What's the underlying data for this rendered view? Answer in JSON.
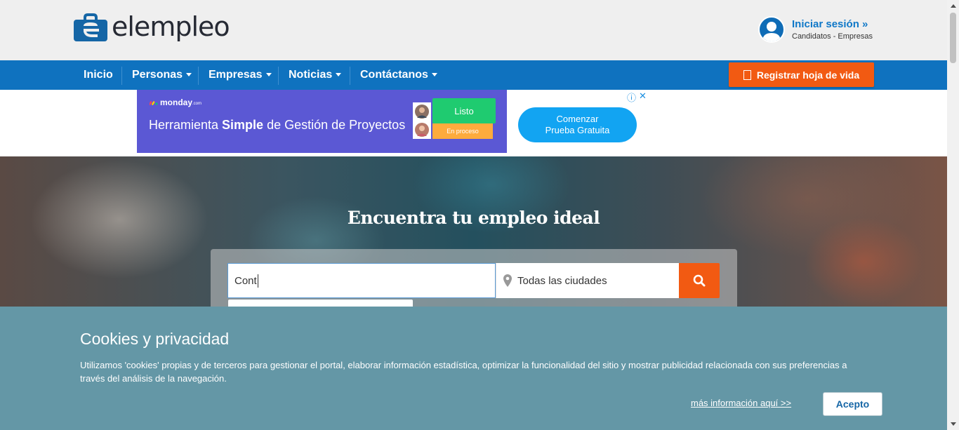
{
  "brand": {
    "name": "elempleo",
    "logo_icon": "briefcase-e-logo"
  },
  "login": {
    "title": "Iniciar sesión »",
    "subtitle": "Candidatos - Empresas",
    "icon": "user-avatar-icon"
  },
  "nav": {
    "items": [
      {
        "label": "Inicio"
      },
      {
        "label": "Personas"
      },
      {
        "label": "Empresas"
      },
      {
        "label": "Noticias"
      },
      {
        "label": "Contáctanos"
      }
    ],
    "register_label": "Registrar hoja de vida",
    "colors": {
      "nav_bg": "#0f72bf",
      "accent": "#f25a12"
    }
  },
  "ad": {
    "brand": "monday",
    "brand_suffix": ".com",
    "headline_pre": "Herramienta ",
    "headline_bold": "Simple",
    "headline_post": " de Gestión de Proyectos",
    "status_done": "Listo",
    "status_progress": "En proceso",
    "cta_line1": "Comenzar",
    "cta_line2": "Prueba Gratuita",
    "controls": [
      "ⓘ",
      "✕"
    ]
  },
  "hero": {
    "title": "Encuentra tu empleo ideal",
    "search_value": "Cont",
    "city_value": "Todas las ciudades"
  },
  "cookies": {
    "title": "Cookies y privacidad",
    "text": "Utilizamos 'cookies' propias y de terceros para gestionar el portal, elaborar información estadística, optimizar la funcionalidad del sitio y mostrar publicidad relacionada con sus preferencias a través del análisis de la navegación.",
    "more_link": "más información aquí >>",
    "accept_label": "Acepto"
  }
}
